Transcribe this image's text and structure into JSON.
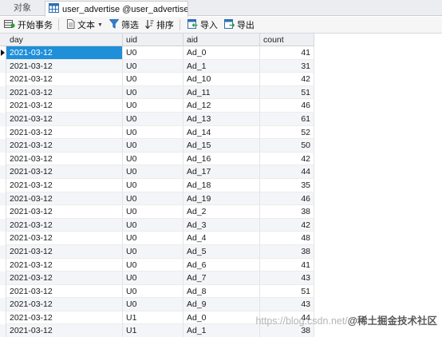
{
  "tabs": {
    "objects_label": "对象",
    "active_label": "user_advertise @user_advertise (cen..."
  },
  "toolbar": {
    "begin_transaction": "开始事务",
    "text": "文本",
    "filter": "筛选",
    "sort": "排序",
    "import": "导入",
    "export": "导出"
  },
  "columns": [
    "day",
    "uid",
    "aid",
    "count"
  ],
  "rows": [
    [
      "2021-03-12",
      "U0",
      "Ad_0",
      "41"
    ],
    [
      "2021-03-12",
      "U0",
      "Ad_1",
      "31"
    ],
    [
      "2021-03-12",
      "U0",
      "Ad_10",
      "42"
    ],
    [
      "2021-03-12",
      "U0",
      "Ad_11",
      "51"
    ],
    [
      "2021-03-12",
      "U0",
      "Ad_12",
      "46"
    ],
    [
      "2021-03-12",
      "U0",
      "Ad_13",
      "61"
    ],
    [
      "2021-03-12",
      "U0",
      "Ad_14",
      "52"
    ],
    [
      "2021-03-12",
      "U0",
      "Ad_15",
      "50"
    ],
    [
      "2021-03-12",
      "U0",
      "Ad_16",
      "42"
    ],
    [
      "2021-03-12",
      "U0",
      "Ad_17",
      "44"
    ],
    [
      "2021-03-12",
      "U0",
      "Ad_18",
      "35"
    ],
    [
      "2021-03-12",
      "U0",
      "Ad_19",
      "46"
    ],
    [
      "2021-03-12",
      "U0",
      "Ad_2",
      "38"
    ],
    [
      "2021-03-12",
      "U0",
      "Ad_3",
      "42"
    ],
    [
      "2021-03-12",
      "U0",
      "Ad_4",
      "48"
    ],
    [
      "2021-03-12",
      "U0",
      "Ad_5",
      "38"
    ],
    [
      "2021-03-12",
      "U0",
      "Ad_6",
      "41"
    ],
    [
      "2021-03-12",
      "U0",
      "Ad_7",
      "43"
    ],
    [
      "2021-03-12",
      "U0",
      "Ad_8",
      "51"
    ],
    [
      "2021-03-12",
      "U0",
      "Ad_9",
      "43"
    ],
    [
      "2021-03-12",
      "U1",
      "Ad_0",
      "44"
    ],
    [
      "2021-03-12",
      "U1",
      "Ad_1",
      "38"
    ]
  ],
  "watermark": {
    "url": "https://blog.csdn.net/",
    "brand": "@稀土掘金技术社区"
  },
  "colors": {
    "selection": "#1f8fd9",
    "grid_line": "#e4e4e4",
    "header_bg": "#eef0f4"
  },
  "icons": [
    "table-icon",
    "transaction-icon",
    "text-icon",
    "filter-icon",
    "sort-icon",
    "import-icon",
    "export-icon"
  ]
}
